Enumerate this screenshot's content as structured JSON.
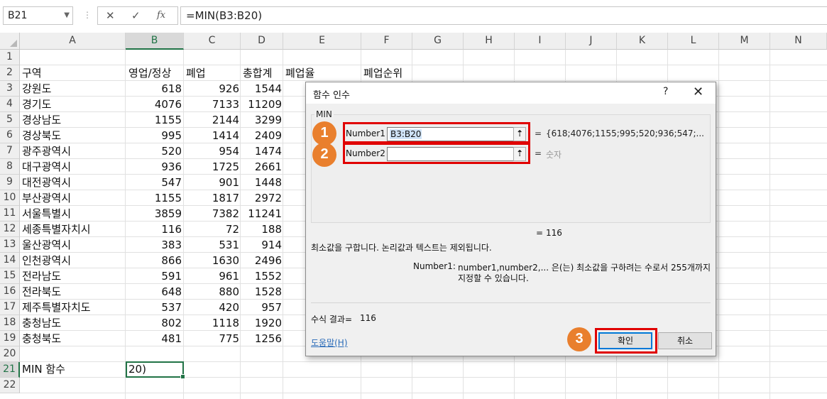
{
  "formula_bar": {
    "name_box": "B21",
    "cancel_icon": "✕",
    "enter_icon": "✓",
    "fx_label": "fx",
    "formula": "=MIN(B3:B20)"
  },
  "columns": [
    "A",
    "B",
    "C",
    "D",
    "E",
    "F",
    "G",
    "H",
    "I",
    "J",
    "K",
    "L",
    "M",
    "N"
  ],
  "selected_column": "B",
  "rows": [
    "1",
    "2",
    "3",
    "4",
    "5",
    "6",
    "7",
    "8",
    "9",
    "10",
    "11",
    "12",
    "13",
    "14",
    "15",
    "16",
    "17",
    "18",
    "19",
    "20",
    "21",
    "22"
  ],
  "selected_row": "21",
  "headers": {
    "a": "구역",
    "b": "영업/정상",
    "c": "폐업",
    "d": "총합계",
    "e": "폐업율",
    "f": "폐업순위"
  },
  "table": [
    {
      "region": "강원도",
      "open": "618",
      "closed": "926",
      "total": "1544"
    },
    {
      "region": "경기도",
      "open": "4076",
      "closed": "7133",
      "total": "11209"
    },
    {
      "region": "경상남도",
      "open": "1155",
      "closed": "2144",
      "total": "3299"
    },
    {
      "region": "경상북도",
      "open": "995",
      "closed": "1414",
      "total": "2409"
    },
    {
      "region": "광주광역시",
      "open": "520",
      "closed": "954",
      "total": "1474"
    },
    {
      "region": "대구광역시",
      "open": "936",
      "closed": "1725",
      "total": "2661"
    },
    {
      "region": "대전광역시",
      "open": "547",
      "closed": "901",
      "total": "1448"
    },
    {
      "region": "부산광역시",
      "open": "1155",
      "closed": "1817",
      "total": "2972"
    },
    {
      "region": "서울특별시",
      "open": "3859",
      "closed": "7382",
      "total": "11241"
    },
    {
      "region": "세종특별자치시",
      "open": "116",
      "closed": "72",
      "total": "188"
    },
    {
      "region": "울산광역시",
      "open": "383",
      "closed": "531",
      "total": "914"
    },
    {
      "region": "인천광역시",
      "open": "866",
      "closed": "1630",
      "total": "2496"
    },
    {
      "region": "전라남도",
      "open": "591",
      "closed": "961",
      "total": "1552"
    },
    {
      "region": "전라북도",
      "open": "648",
      "closed": "880",
      "total": "1528"
    },
    {
      "region": "제주특별자치도",
      "open": "537",
      "closed": "420",
      "total": "957"
    },
    {
      "region": "충청남도",
      "open": "802",
      "closed": "1118",
      "total": "1920"
    },
    {
      "region": "충청북도",
      "open": "481",
      "closed": "775",
      "total": "1256"
    }
  ],
  "row21": {
    "label": "MIN 함수",
    "value": "20)"
  },
  "dialog": {
    "title": "함수 인수",
    "help_glyph": "?",
    "close_glyph": "✕",
    "function_name": "MIN",
    "arg1_label": "Number1",
    "arg1_value": "B3:B20",
    "arg1_result": "{618;4076;1155;995;520;936;547;...",
    "arg2_label": "Number2",
    "arg2_value": "",
    "arg2_hint": "숫자",
    "equals": "=",
    "result_line": "116",
    "description": "최소값을 구합니다. 논리값과 텍스트는 제외됩니다.",
    "arg_desc_label": "Number1:",
    "arg_desc_line1": "number1,number2,... 은(는) 최소값을 구하려는 수로서 255개까지",
    "arg_desc_line2": "지정할 수 있습니다.",
    "formula_result_label": "수식 결과=",
    "formula_result_value": "116",
    "help_link": "도움말(H)",
    "ok_label": "확인",
    "cancel_label": "취소",
    "ref_icon": "⇡"
  },
  "badges": [
    "1",
    "2",
    "3"
  ],
  "colors": {
    "accent_green": "#217346",
    "badge_orange": "#e97f2d",
    "highlight_red": "#e00000",
    "focus_blue": "#0078d7"
  }
}
